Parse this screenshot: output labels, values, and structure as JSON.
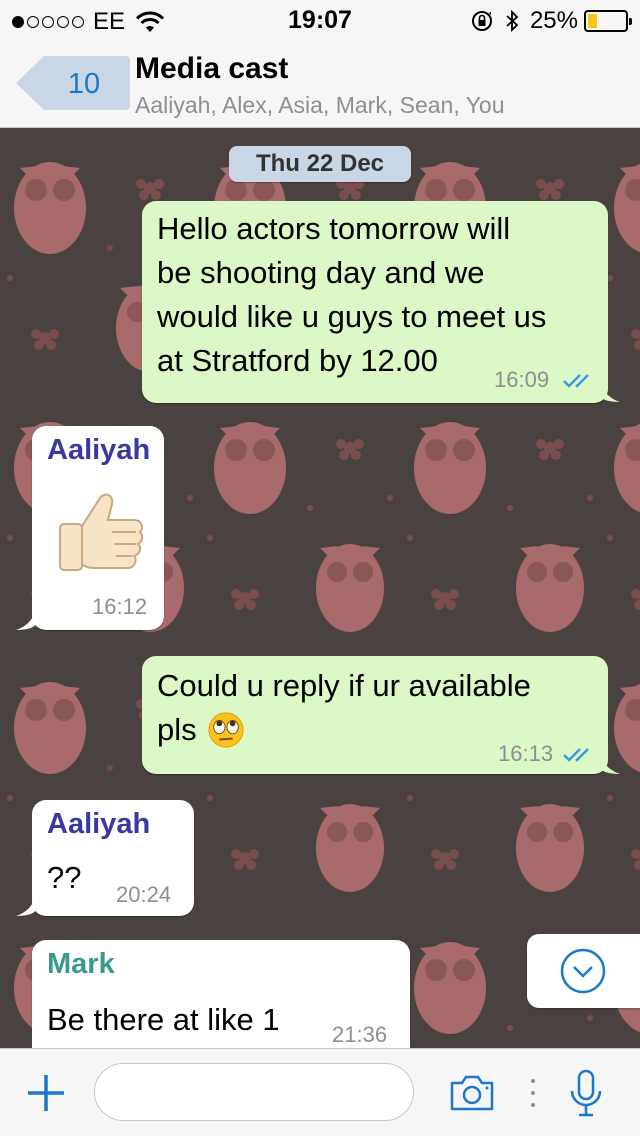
{
  "status_bar": {
    "carrier": "EE",
    "time": "19:07",
    "battery_percent": "25%",
    "battery_level": 0.25,
    "signal_bars_filled": 1,
    "signal_bars_total": 5
  },
  "header": {
    "back_count": "10",
    "title": "Media cast",
    "members": "Aaliyah, Alex, Asia, Mark, Sean, You"
  },
  "chat": {
    "date_divider": "Thu 22 Dec",
    "messages": [
      {
        "direction": "outgoing",
        "lines": [
          "Hello actors tomorrow will",
          "be shooting day and we",
          "would like u guys to meet us",
          "at Stratford by 12.00"
        ],
        "time": "16:09",
        "status": "read"
      },
      {
        "direction": "incoming",
        "sender": "Aaliyah",
        "content": "thumbs-up-emoji",
        "time": "16:12"
      },
      {
        "direction": "outgoing",
        "lines": [
          "Could u reply if ur available",
          "pls"
        ],
        "emoji": "eye-roll-emoji",
        "time": "16:13",
        "status": "read"
      },
      {
        "direction": "incoming",
        "sender": "Aaliyah",
        "text": "??",
        "time": "20:24"
      },
      {
        "direction": "incoming",
        "sender": "Mark",
        "text": "Be there at like 1",
        "time": "21:36"
      }
    ]
  },
  "input": {
    "placeholder": ""
  },
  "colors": {
    "accent": "#1a78c8",
    "outgoing_bubble": "#dcf8c6",
    "incoming_bubble": "#ffffff",
    "sender_aaliyah": "#3a3a9e",
    "sender_mark": "#3a9a8a",
    "wallpaper": "#4a4240"
  }
}
